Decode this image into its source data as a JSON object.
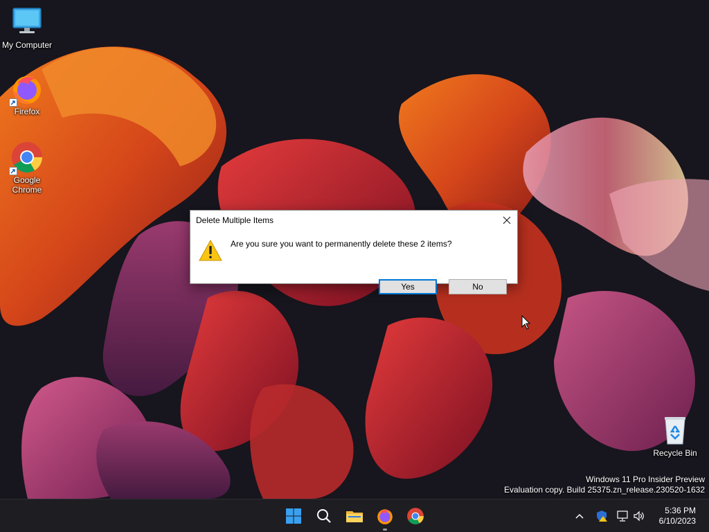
{
  "desktop": {
    "icons": [
      {
        "label": "My Computer",
        "icon": "monitor-icon"
      },
      {
        "label": "Firefox",
        "icon": "firefox-icon"
      },
      {
        "label": "Google Chrome",
        "icon": "chrome-icon"
      },
      {
        "label": "Recycle Bin",
        "icon": "recycle-bin-icon"
      }
    ],
    "watermark": {
      "line1": "Windows 11 Pro Insider Preview",
      "line2": "Evaluation copy. Build 25375.zn_release.230520-1632"
    }
  },
  "dialog": {
    "title": "Delete Multiple Items",
    "message": "Are you sure you want to permanently delete these 2 items?",
    "icon": "warning-icon",
    "buttons": {
      "yes": "Yes",
      "no": "No"
    },
    "close_icon": "close-icon"
  },
  "taskbar": {
    "items": [
      "start-icon",
      "search-icon",
      "file-explorer-icon",
      "firefox-icon",
      "chrome-icon"
    ],
    "tray": [
      "chevron-up-icon",
      "security-icon",
      "network-icon",
      "volume-icon"
    ],
    "clock": {
      "time": "5:36 PM",
      "date": "6/10/2023"
    }
  },
  "colors": {
    "accent": "#0078d7",
    "taskbar": "#1e1d22",
    "dialog_bg": "#f0f0f0"
  }
}
